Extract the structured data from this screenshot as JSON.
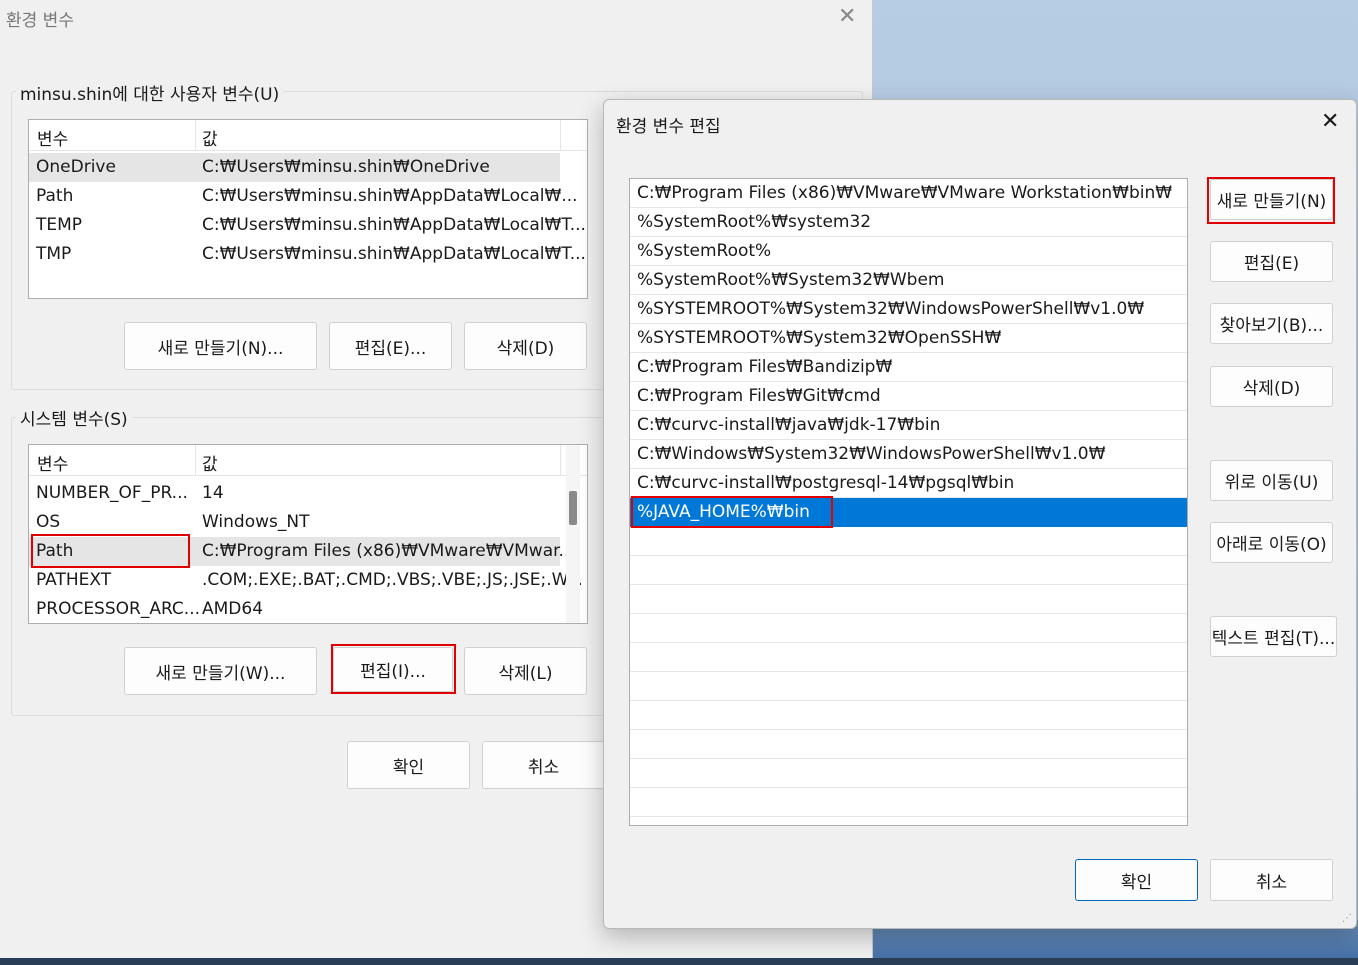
{
  "main_window": {
    "title": "환경 변수",
    "close_glyph": "✕",
    "user_group_label": "minsu.shin에 대한 사용자 변수(U)",
    "user_vars": {
      "col_name": "변수",
      "col_value": "값",
      "rows": [
        {
          "name": "OneDrive",
          "value": "C:₩Users₩minsu.shin₩OneDrive"
        },
        {
          "name": "Path",
          "value": "C:₩Users₩minsu.shin₩AppData₩Local₩..."
        },
        {
          "name": "TEMP",
          "value": "C:₩Users₩minsu.shin₩AppData₩Local₩T..."
        },
        {
          "name": "TMP",
          "value": "C:₩Users₩minsu.shin₩AppData₩Local₩T..."
        }
      ],
      "new_button": "새로 만들기(N)...",
      "edit_button": "편집(E)...",
      "delete_button": "삭제(D)"
    },
    "system_group_label": "시스템 변수(S)",
    "system_vars": {
      "col_name": "변수",
      "col_value": "값",
      "rows": [
        {
          "name": "NUMBER_OF_PR...",
          "value": "14"
        },
        {
          "name": "OS",
          "value": "Windows_NT"
        },
        {
          "name": "Path",
          "value": "C:₩Program Files (x86)₩VMware₩VMwar..."
        },
        {
          "name": "PATHEXT",
          "value": ".COM;.EXE;.BAT;.CMD;.VBS;.VBE;.JS;.JSE;.W..."
        },
        {
          "name": "PROCESSOR_ARC...",
          "value": "AMD64"
        }
      ],
      "new_button": "새로 만들기(W)...",
      "edit_button": "편집(I)...",
      "delete_button": "삭제(L)"
    },
    "ok_button": "확인",
    "cancel_button": "취소"
  },
  "edit_dialog": {
    "title": "환경 변수 편집",
    "close_glyph": "✕",
    "entries": [
      "C:₩Program Files (x86)₩VMware₩VMware Workstation₩bin₩",
      "%SystemRoot%₩system32",
      "%SystemRoot%",
      "%SystemRoot%₩System32₩Wbem",
      "%SYSTEMROOT%₩System32₩WindowsPowerShell₩v1.0₩",
      "%SYSTEMROOT%₩System32₩OpenSSH₩",
      "C:₩Program Files₩Bandizip₩",
      "C:₩Program Files₩Git₩cmd",
      "C:₩curvc-install₩java₩jdk-17₩bin",
      "C:₩Windows₩System32₩WindowsPowerShell₩v1.0₩",
      "C:₩curvc-install₩postgresql-14₩pgsql₩bin",
      "%JAVA_HOME%₩bin"
    ],
    "selected_entry": "%JAVA_HOME%₩bin",
    "buttons": {
      "new": "새로 만들기(N)",
      "edit": "편집(E)",
      "browse": "찾아보기(B)...",
      "delete": "삭제(D)",
      "move_up": "위로 이동(U)",
      "move_down": "아래로 이동(O)",
      "edit_text": "텍스트 편집(T)..."
    },
    "ok_button": "확인",
    "cancel_button": "취소",
    "resize_glyph": "⋰"
  },
  "highlight_color": "#e00000",
  "selection_color": "#0078d7"
}
